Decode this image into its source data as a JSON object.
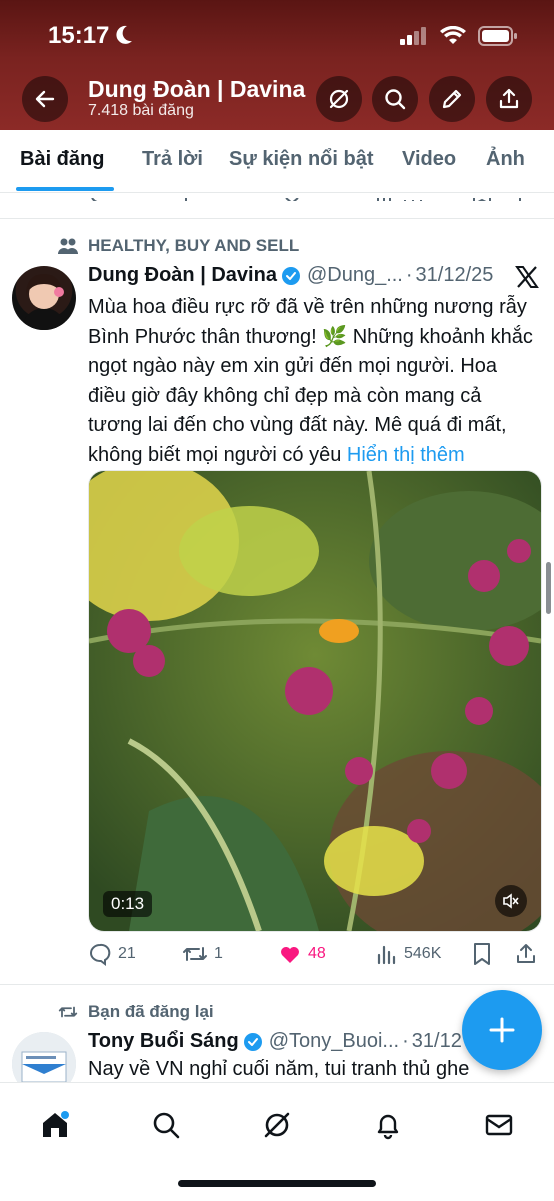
{
  "status_bar": {
    "time": "15:17",
    "icons": [
      "moon-icon",
      "signal-icon",
      "wifi-icon",
      "battery-icon"
    ]
  },
  "header": {
    "name": "Dung Đoàn | Davina",
    "post_count": "7.418 bài đăng",
    "buttons": [
      "back-icon",
      "grok-icon",
      "search-icon",
      "edit-icon",
      "share-icon"
    ],
    "bg_color": "#7a2320"
  },
  "tabs": [
    {
      "label": "Bài đăng",
      "active": true
    },
    {
      "label": "Trả lời",
      "active": false
    },
    {
      "label": "Sự kiện nổi bật",
      "active": false
    },
    {
      "label": "Video",
      "active": false
    },
    {
      "label": "Ảnh",
      "active": false
    }
  ],
  "tweet1": {
    "context": "HEALTHY, BUY AND SELL",
    "name": "Dung Đoàn | Davina",
    "handle": "@Dung_...",
    "date": "31/12/25",
    "text": "Mùa hoa điều rực rỡ đã về trên những nương rẫy Bình Phước thân thương! 🌿 Những khoảnh khắc ngọt ngào này em xin gửi đến mọi người. Hoa điều giờ đây không chỉ đẹp mà còn mang cả tương lai đến cho vùng đất này. Mê quá đi mất, không biết mọi người có yêu",
    "show_more": "Hiển thị thêm",
    "video_duration": "0:13",
    "replies": "21",
    "reposts": "1",
    "likes": "48",
    "views": "546K"
  },
  "tweet2": {
    "context": "Bạn đã đăng lại",
    "name": "Tony Buổi Sáng",
    "handle": "@Tony_Buoi...",
    "date": "31/12",
    "text": "Nay về VN nghỉ cuối năm, tui tranh thủ ghe"
  },
  "accent_color": "#1d9bf0",
  "like_color": "#f91880"
}
